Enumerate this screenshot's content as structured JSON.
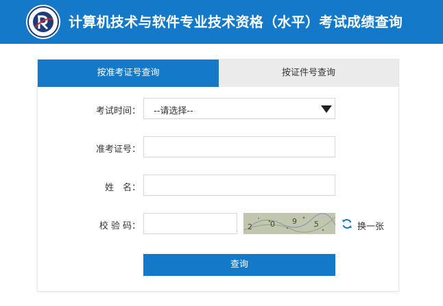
{
  "header": {
    "title": "计算机技术与软件专业技术资格（水平）考试成绩查询",
    "logo_icon": "exam-center-seal"
  },
  "tabs": [
    {
      "label": "按准考证号查询",
      "active": true
    },
    {
      "label": "按证件号查询",
      "active": false
    }
  ],
  "form": {
    "exam_time_label": "考试时间：",
    "exam_time_value": "--请选择--",
    "ticket_label": "准考证号：",
    "ticket_value": "",
    "name_label": "姓　名：",
    "name_value": "",
    "captcha_label": "校 验 码：",
    "captcha_value": "",
    "captcha_chars": [
      "2",
      "0",
      "9",
      "5"
    ],
    "refresh_label": "换一张",
    "submit_label": "查询"
  },
  "colors": {
    "brand": "#1479c9",
    "tab_inactive": "#ebebeb"
  }
}
